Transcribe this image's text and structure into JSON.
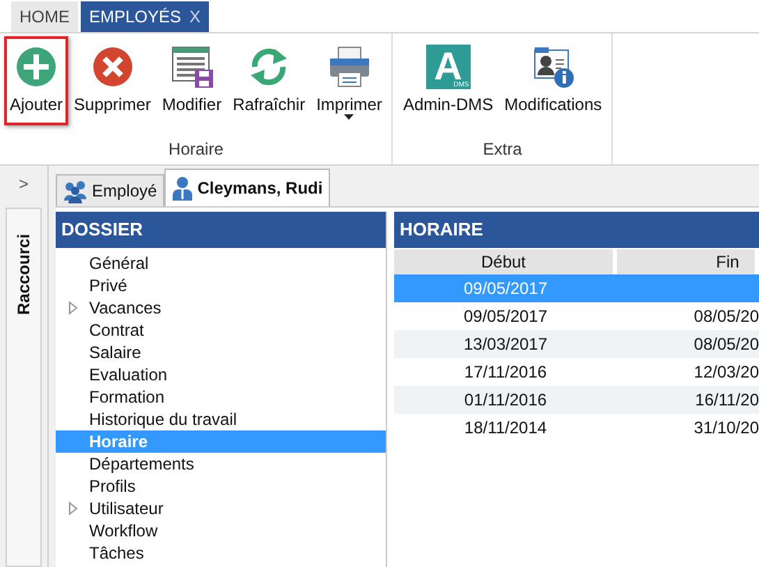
{
  "app_tabs": [
    {
      "label": "HOME",
      "selected": false,
      "closable": false
    },
    {
      "label": "EMPLOYÉS",
      "selected": true,
      "closable": true,
      "close": "X"
    }
  ],
  "ribbon": {
    "groups": [
      {
        "label": "Horaire",
        "buttons": [
          {
            "label": "Ajouter",
            "kind": "add",
            "highlighted": true,
            "dropdown": false
          },
          {
            "label": "Supprimer",
            "kind": "delete",
            "highlighted": false,
            "dropdown": false
          },
          {
            "label": "Modifier",
            "kind": "edit",
            "highlighted": false,
            "dropdown": false
          },
          {
            "label": "Rafraîchir",
            "kind": "refresh",
            "highlighted": false,
            "dropdown": false
          },
          {
            "label": "Imprimer",
            "kind": "print",
            "highlighted": false,
            "dropdown": true
          }
        ]
      },
      {
        "label": "Extra",
        "buttons": [
          {
            "label": "Admin-DMS",
            "kind": "logo",
            "highlighted": false,
            "dropdown": false,
            "logo_letter": "A",
            "logo_sub": "DMS"
          },
          {
            "label": "Modifications",
            "kind": "info",
            "highlighted": false,
            "dropdown": false
          }
        ]
      }
    ]
  },
  "shortcut_bar": {
    "expand": ">",
    "label": "Raccourci"
  },
  "doc_tabs": [
    {
      "label": "Employé",
      "kind": "group",
      "selected": false
    },
    {
      "label": "Cleymans, Rudi",
      "kind": "person",
      "selected": true
    }
  ],
  "dossier": {
    "title": "DOSSIER",
    "items": [
      {
        "label": "Général",
        "expandable": false,
        "selected": false
      },
      {
        "label": "Privé",
        "expandable": false,
        "selected": false
      },
      {
        "label": "Vacances",
        "expandable": true,
        "selected": false
      },
      {
        "label": "Contrat",
        "expandable": false,
        "selected": false
      },
      {
        "label": "Salaire",
        "expandable": false,
        "selected": false
      },
      {
        "label": "Evaluation",
        "expandable": false,
        "selected": false
      },
      {
        "label": "Formation",
        "expandable": false,
        "selected": false
      },
      {
        "label": "Historique du travail",
        "expandable": false,
        "selected": false
      },
      {
        "label": "Horaire",
        "expandable": false,
        "selected": true
      },
      {
        "label": "Départements",
        "expandable": false,
        "selected": false
      },
      {
        "label": "Profils",
        "expandable": false,
        "selected": false
      },
      {
        "label": "Utilisateur",
        "expandable": true,
        "selected": false
      },
      {
        "label": "Workflow",
        "expandable": false,
        "selected": false
      },
      {
        "label": "Tâches",
        "expandable": false,
        "selected": false
      }
    ]
  },
  "horaire": {
    "title": "HORAIRE",
    "columns": [
      "Début",
      "Fin"
    ],
    "rows": [
      {
        "cells": [
          "09/05/2017",
          ""
        ],
        "selected": true
      },
      {
        "cells": [
          "09/05/2017",
          "08/05/20"
        ],
        "selected": false
      },
      {
        "cells": [
          "13/03/2017",
          "08/05/20"
        ],
        "selected": false
      },
      {
        "cells": [
          "17/11/2016",
          "12/03/20"
        ],
        "selected": false
      },
      {
        "cells": [
          "01/11/2016",
          "16/11/20"
        ],
        "selected": false
      },
      {
        "cells": [
          "18/11/2014",
          "31/10/20"
        ],
        "selected": false
      }
    ]
  }
}
